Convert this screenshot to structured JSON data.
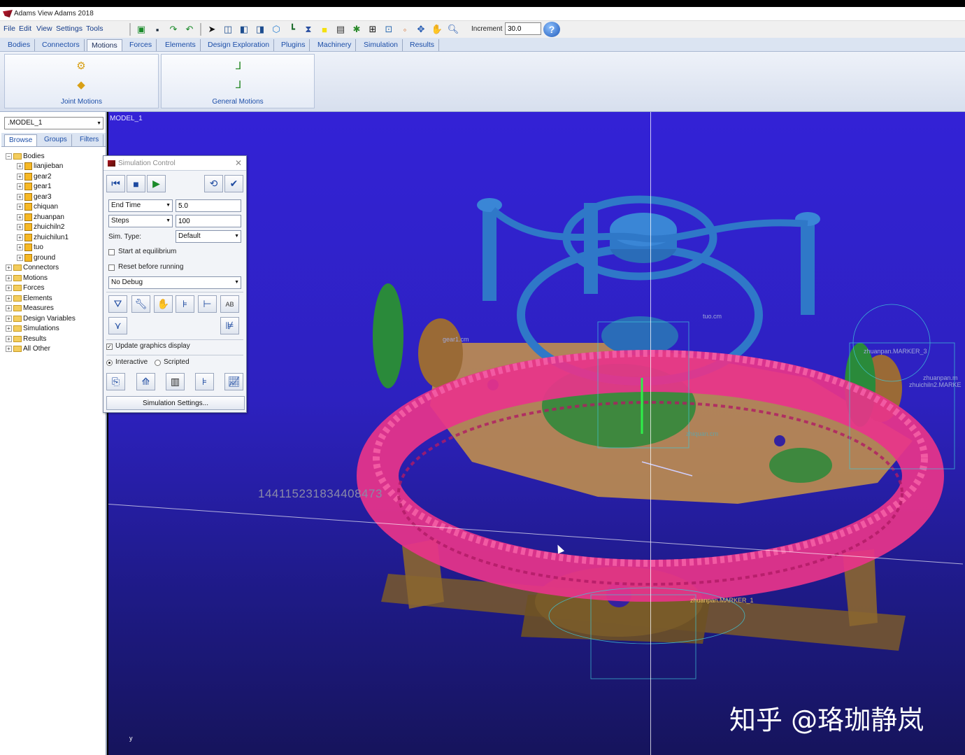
{
  "app": {
    "title": "Adams View Adams 2018"
  },
  "menu": [
    "File",
    "Edit",
    "View",
    "Settings",
    "Tools"
  ],
  "toolbar": {
    "icons": [
      "new-icon",
      "save-icon",
      "redo-icon",
      "undo-icon",
      "select-icon",
      "view-front-icon",
      "view-top-icon",
      "view-side-icon",
      "iso-icon",
      "triad-icon",
      "render-icon",
      "color-icon",
      "info-icon",
      "plugin-icon",
      "grid-icon",
      "zoom-box-icon",
      "point-icon",
      "rotate-icon",
      "pan-icon",
      "zoom-icon"
    ],
    "increment_label": "Increment",
    "increment_value": "30.0"
  },
  "tabs": [
    "Bodies",
    "Connectors",
    "Motions",
    "Forces",
    "Elements",
    "Design Exploration",
    "Plugins",
    "Machinery",
    "Simulation",
    "Results"
  ],
  "active_tab": "Motions",
  "ribbon": {
    "groups": [
      {
        "label": "Joint Motions"
      },
      {
        "label": "General Motions"
      }
    ]
  },
  "browser": {
    "model": ".MODEL_1",
    "tabs": [
      "Browse",
      "Groups",
      "Filters"
    ],
    "tree": [
      {
        "label": "Bodies",
        "level": 0,
        "expanded": true,
        "kind": "folder"
      },
      {
        "label": "lianjieban",
        "level": 1,
        "kind": "body"
      },
      {
        "label": "gear2",
        "level": 1,
        "kind": "body"
      },
      {
        "label": "gear1",
        "level": 1,
        "kind": "body"
      },
      {
        "label": "gear3",
        "level": 1,
        "kind": "body"
      },
      {
        "label": "chiquan",
        "level": 1,
        "kind": "body"
      },
      {
        "label": "zhuanpan",
        "level": 1,
        "kind": "body"
      },
      {
        "label": "zhuichiln2",
        "level": 1,
        "kind": "body"
      },
      {
        "label": "zhuichilun1",
        "level": 1,
        "kind": "body"
      },
      {
        "label": "tuo",
        "level": 1,
        "kind": "body"
      },
      {
        "label": "ground",
        "level": 1,
        "kind": "body"
      },
      {
        "label": "Connectors",
        "level": 0,
        "kind": "folder"
      },
      {
        "label": "Motions",
        "level": 0,
        "kind": "folder"
      },
      {
        "label": "Forces",
        "level": 0,
        "kind": "folder"
      },
      {
        "label": "Elements",
        "level": 0,
        "kind": "folder"
      },
      {
        "label": "Measures",
        "level": 0,
        "kind": "folder"
      },
      {
        "label": "Design Variables",
        "level": 0,
        "kind": "folder"
      },
      {
        "label": "Simulations",
        "level": 0,
        "kind": "folder"
      },
      {
        "label": "Results",
        "level": 0,
        "kind": "folder"
      },
      {
        "label": "All Other",
        "level": 0,
        "kind": "folder"
      }
    ]
  },
  "viewport": {
    "model_label": "MODEL_1",
    "watermark_number": "144115231834408473",
    "watermark_brand": "知乎 @珞珈静岚",
    "labels": [
      "zhuanpan.MARKER_1",
      "zhuanpan.MARKER_3",
      "zhuichiln2.MARKE",
      "zhiquan.cm",
      "gear1.cm",
      "tuo.cm",
      "zhuanpan.m"
    ]
  },
  "simulation_control": {
    "title": "Simulation Control",
    "end_time_label": "End Time",
    "end_time_value": "5.0",
    "steps_label": "Steps",
    "steps_value": "100",
    "sim_type_label": "Sim. Type:",
    "sim_type_value": "Default",
    "start_eq_label": "Start at equilibrium",
    "start_eq_checked": false,
    "reset_label": "Reset before running",
    "reset_checked": false,
    "debug_value": "No Debug",
    "update_graphics_label": "Update graphics display",
    "update_graphics_checked": true,
    "interactive_label": "Interactive",
    "scripted_label": "Scripted",
    "mode": "Interactive",
    "settings_label": "Simulation Settings..."
  }
}
